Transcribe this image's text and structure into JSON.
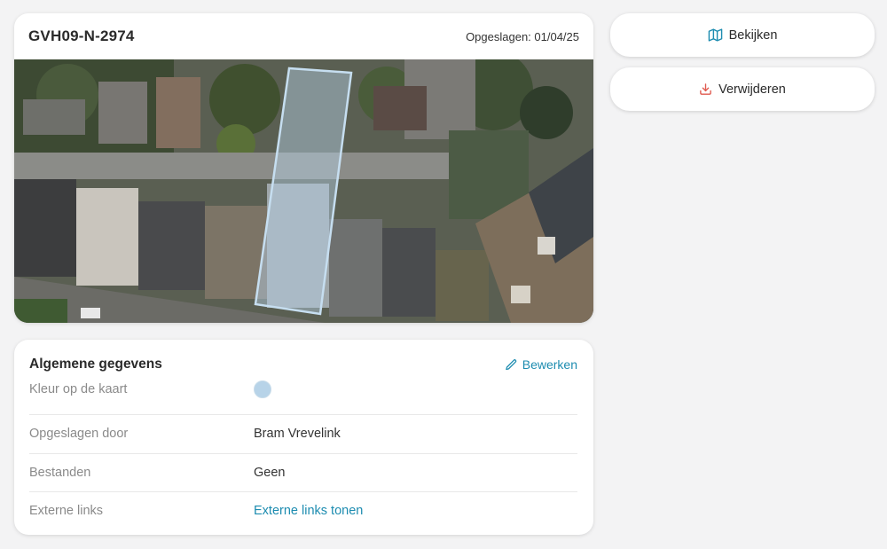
{
  "plot": {
    "title": "GVH09-N-2974",
    "saved_label": "Opgeslagen: 01/04/25"
  },
  "actions": {
    "view_label": "Bekijken",
    "delete_label": "Verwijderen"
  },
  "info": {
    "title": "Algemene gegevens",
    "edit_label": "Bewerken",
    "rows": [
      {
        "label": "Kleur op de kaart",
        "value": ""
      },
      {
        "label": "Opgeslagen door",
        "value": "Bram Vrevelink"
      },
      {
        "label": "Bestanden",
        "value": "Geen"
      },
      {
        "label": "Externe links",
        "value": "Externe links tonen"
      }
    ]
  },
  "colors": {
    "accent": "#1d8cb0",
    "map_color": "#b7d3e8",
    "delete_icon": "#e05a4f"
  },
  "icons": {
    "view": "map-icon",
    "delete": "download-icon",
    "edit": "pencil-icon"
  }
}
